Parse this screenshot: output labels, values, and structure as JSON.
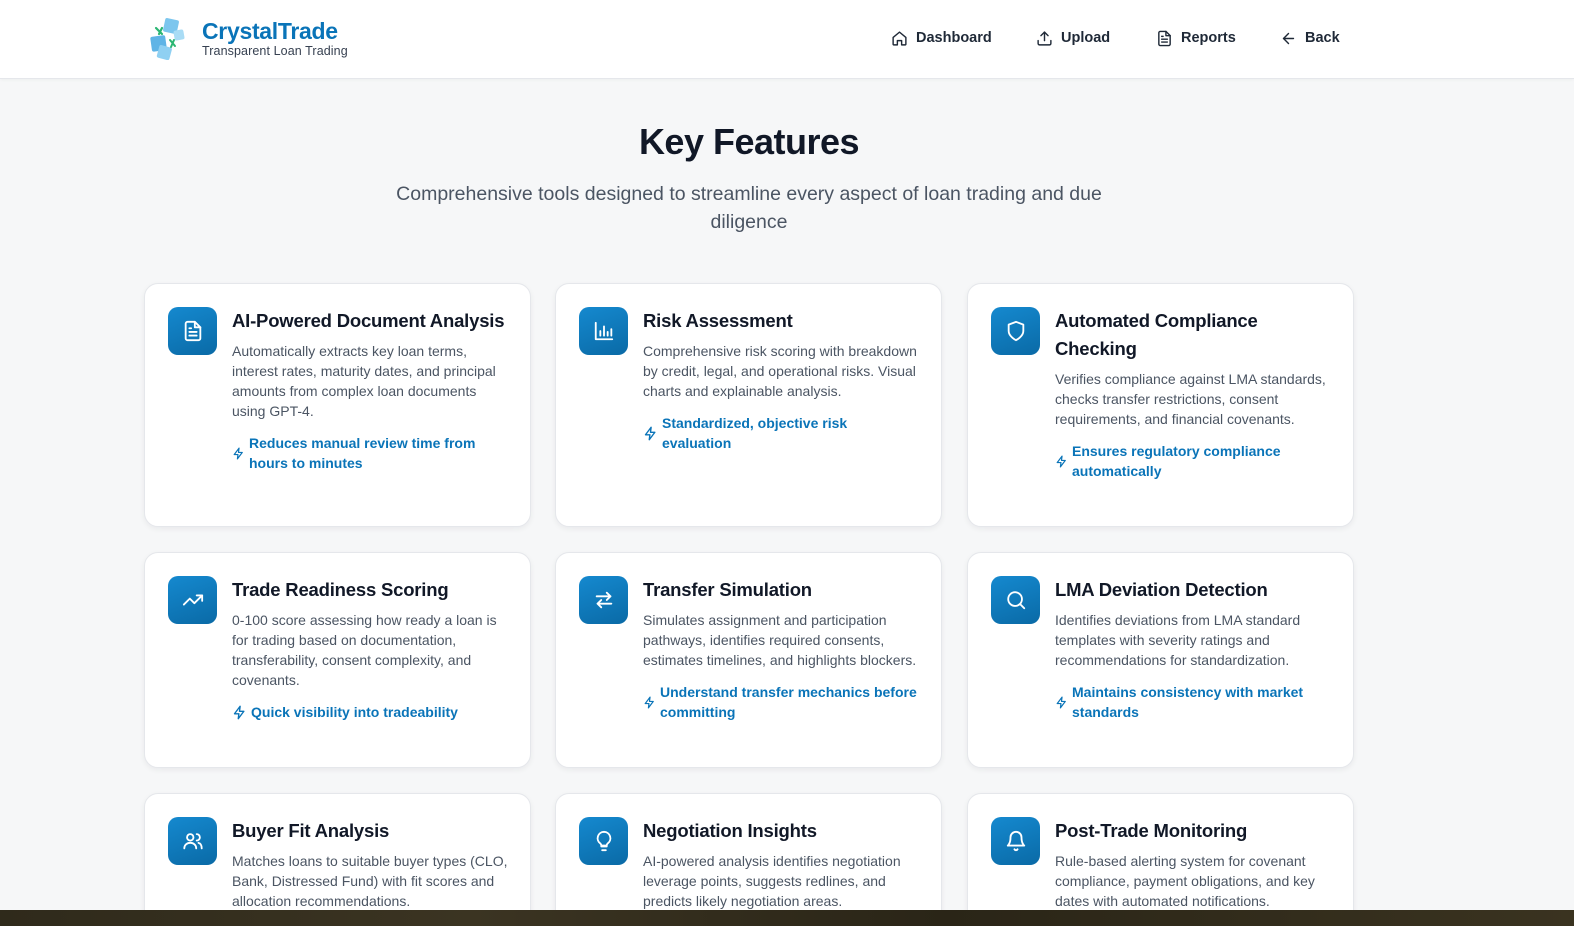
{
  "header": {
    "brand_name": "CrystalTrade",
    "brand_tagline": "Transparent Loan Trading",
    "nav": [
      {
        "label": "Dashboard",
        "icon": "home-icon"
      },
      {
        "label": "Upload",
        "icon": "upload-icon"
      },
      {
        "label": "Reports",
        "icon": "document-icon"
      },
      {
        "label": "Back",
        "icon": "arrow-left-icon"
      }
    ]
  },
  "hero": {
    "title": "Key Features",
    "subtitle": "Comprehensive tools designed to streamline every aspect of loan trading and due diligence"
  },
  "features": [
    {
      "title": "AI-Powered Document Analysis",
      "icon": "document-icon",
      "description": "Automatically extracts key loan terms, interest rates, maturity dates, and principal amounts from complex loan documents using GPT-4.",
      "benefit": "Reduces manual review time from hours to minutes"
    },
    {
      "title": "Risk Assessment",
      "icon": "bar-chart-icon",
      "description": "Comprehensive risk scoring with breakdown by credit, legal, and operational risks. Visual charts and explainable analysis.",
      "benefit": "Standardized, objective risk evaluation"
    },
    {
      "title": "Automated Compliance Checking",
      "icon": "shield-icon",
      "description": "Verifies compliance against LMA standards, checks transfer restrictions, consent requirements, and financial covenants.",
      "benefit": "Ensures regulatory compliance automatically"
    },
    {
      "title": "Trade Readiness Scoring",
      "icon": "trending-up-icon",
      "description": "0-100 score assessing how ready a loan is for trading based on documentation, transferability, consent complexity, and covenants.",
      "benefit": "Quick visibility into tradeability"
    },
    {
      "title": "Transfer Simulation",
      "icon": "transfer-arrows-icon",
      "description": "Simulates assignment and participation pathways, identifies required consents, estimates timelines, and highlights blockers.",
      "benefit": "Understand transfer mechanics before committing"
    },
    {
      "title": "LMA Deviation Detection",
      "icon": "search-icon",
      "description": "Identifies deviations from LMA standard templates with severity ratings and recommendations for standardization.",
      "benefit": "Maintains consistency with market standards"
    },
    {
      "title": "Buyer Fit Analysis",
      "icon": "users-icon",
      "description": "Matches loans to suitable buyer types (CLO, Bank, Distressed Fund) with fit scores and allocation recommendations.",
      "benefit": ""
    },
    {
      "title": "Negotiation Insights",
      "icon": "lightbulb-icon",
      "description": "AI-powered analysis identifies negotiation leverage points, suggests redlines, and predicts likely negotiation areas.",
      "benefit": ""
    },
    {
      "title": "Post-Trade Monitoring",
      "icon": "bell-icon",
      "description": "Rule-based alerting system for covenant compliance, payment obligations, and key dates with automated notifications.",
      "benefit": ""
    }
  ],
  "colors": {
    "accent": "#0a74b8",
    "icon_gradient_start": "#1589cf",
    "icon_gradient_end": "#0a6aa6",
    "page_background": "#f6f7f8"
  }
}
